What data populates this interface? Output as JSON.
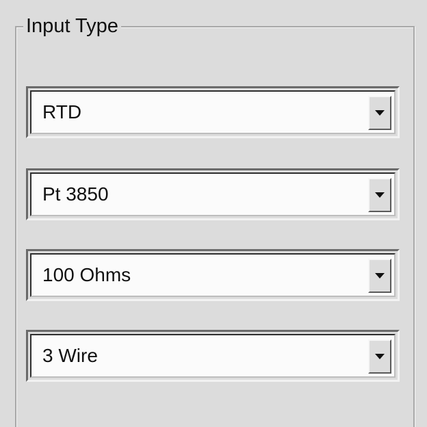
{
  "group": {
    "title": "Input Type"
  },
  "combos": [
    {
      "value": "RTD",
      "icon": "chevron-down-icon"
    },
    {
      "value": "Pt 3850",
      "icon": "chevron-down-icon"
    },
    {
      "value": "100 Ohms",
      "icon": "chevron-down-icon"
    },
    {
      "value": "3 Wire",
      "icon": "chevron-down-icon"
    }
  ]
}
